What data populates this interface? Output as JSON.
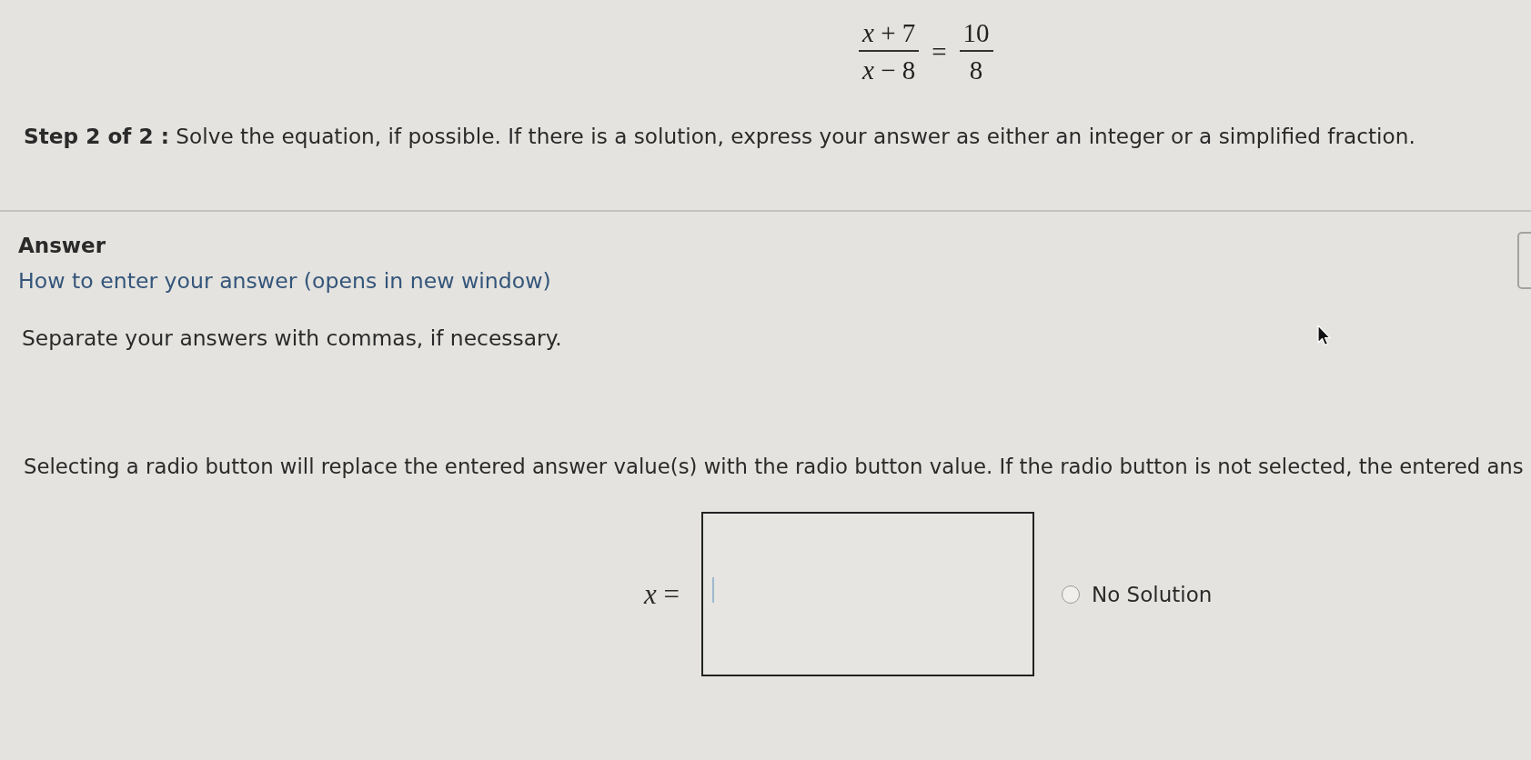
{
  "equation": {
    "left": {
      "numerator": "*x* + 7",
      "denominator": "*x* − 8"
    },
    "equals": "=",
    "right": {
      "numerator": "10",
      "denominator": "8"
    }
  },
  "step": {
    "text": "**Step 2 of 2 :** Solve the equation, if possible. If there is a solution, express your answer as either an integer or a simplified fraction."
  },
  "answer": {
    "heading": "Answer",
    "help_link": "How to enter your answer (opens in new window)",
    "note": "Separate your answers with commas, if necessary.",
    "radio_note": "Selecting a radio button will replace the entered answer value(s) with the radio button value. If the radio button is not selected, the entered ans",
    "variable_label": "*x* =",
    "input": {
      "focused": true
    },
    "options": [
      {
        "label": "No Solution",
        "selected": false
      }
    ]
  }
}
